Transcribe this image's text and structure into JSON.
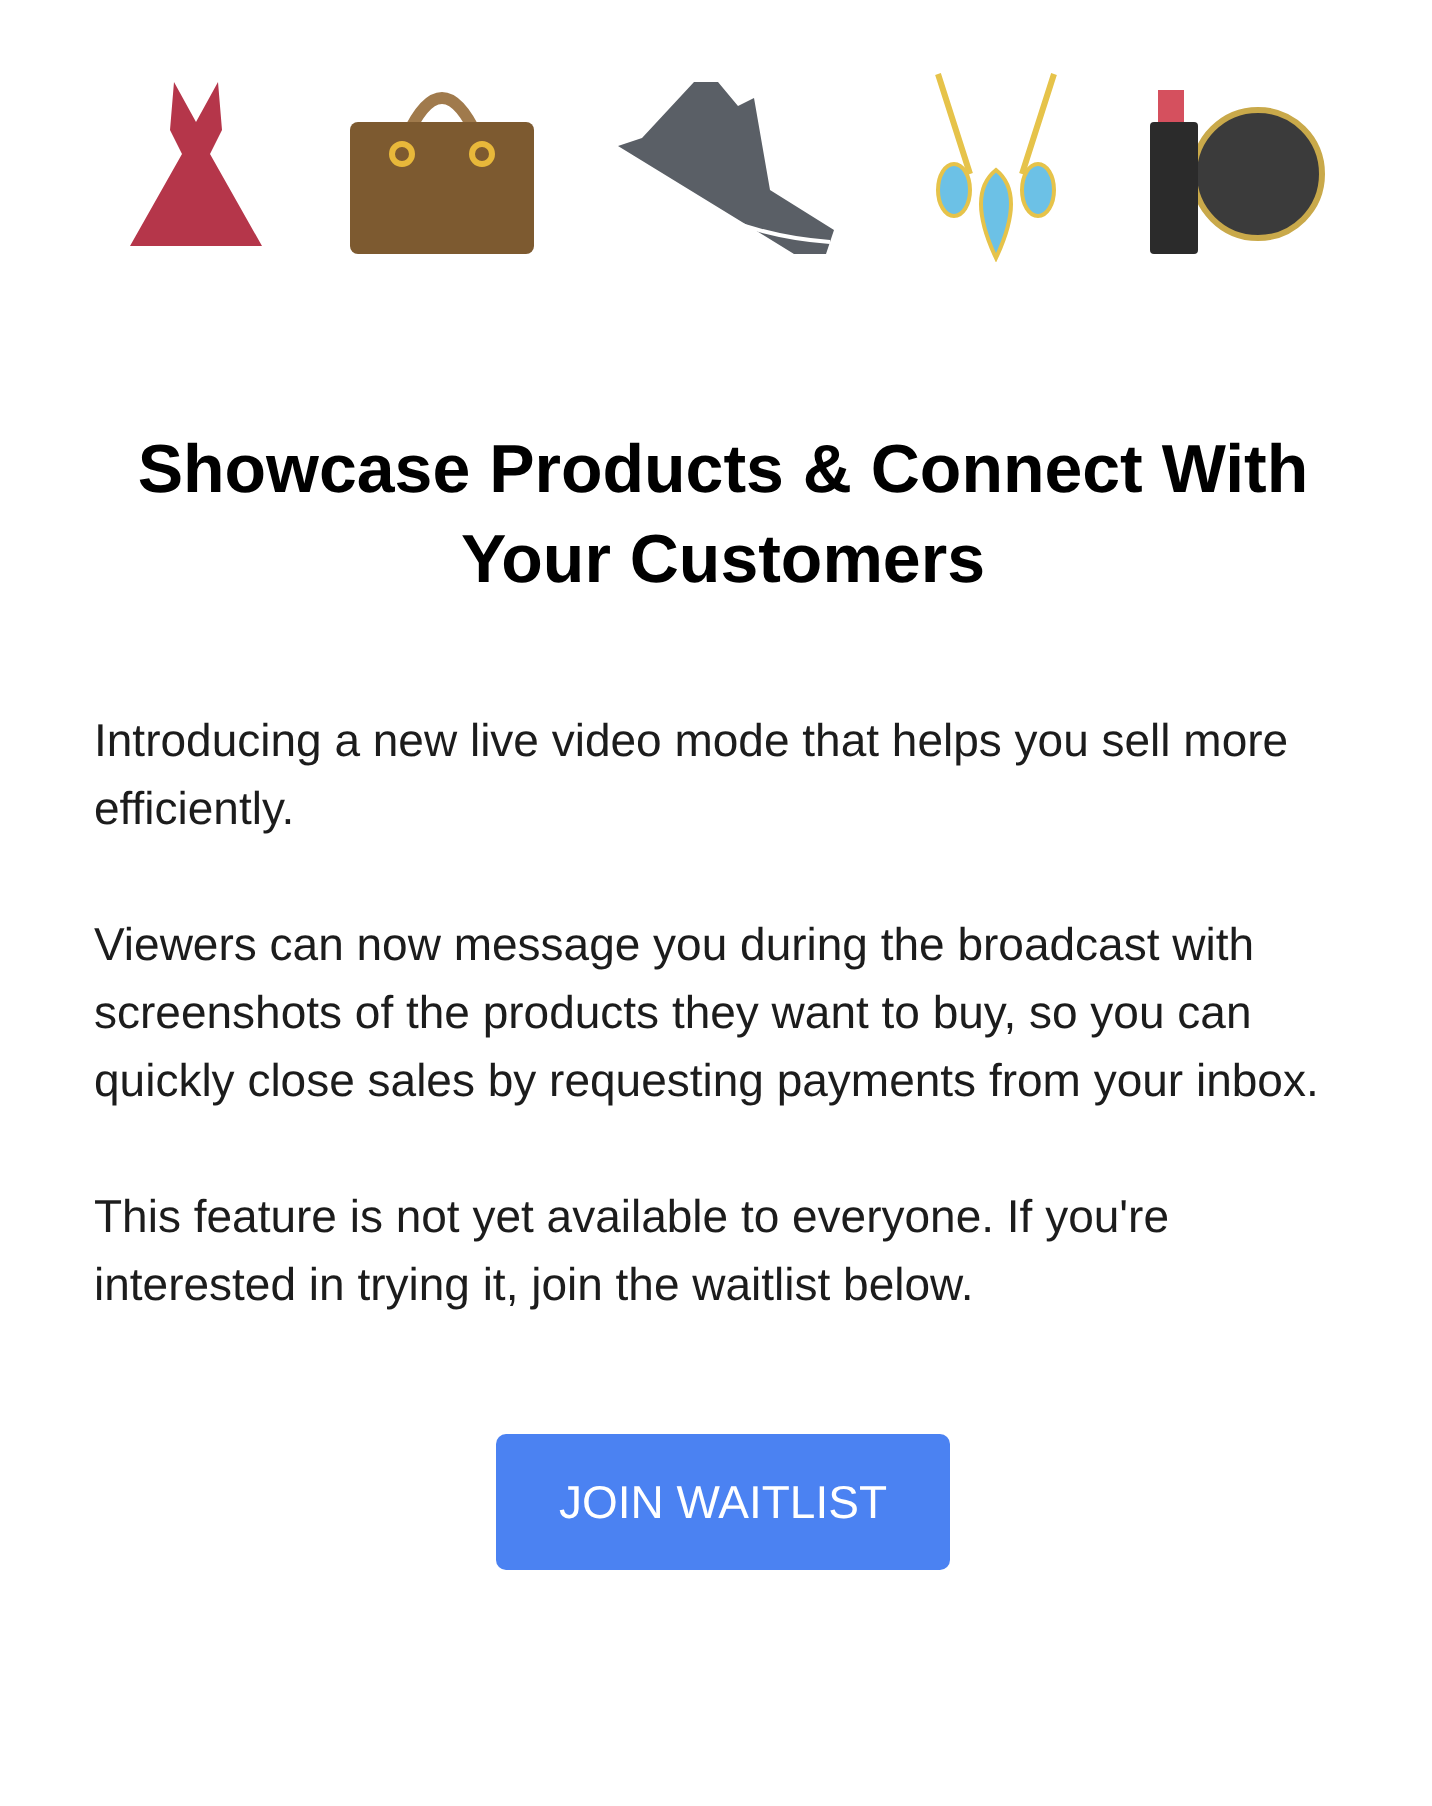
{
  "title": "Showcase Products & Connect With Your Customers",
  "paragraphs": [
    "Introducing a new live video mode that helps you sell more efficiently.",
    "Viewers can now message you during the broadcast with screenshots of the products they want to buy, so you can quickly close sales by requesting payments from your inbox.",
    "This feature is not yet available to everyone. If you're interested in trying it, join the waitlist below."
  ],
  "button": "JOIN WAITLIST"
}
